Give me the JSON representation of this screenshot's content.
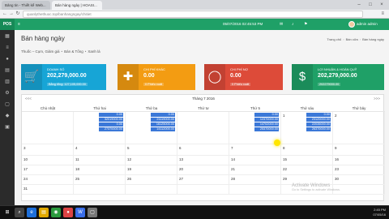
{
  "browser": {
    "tabs": [
      {
        "title": "Bảng tin - Thiết kế Web..."
      },
      {
        "title": "Bán hàng ngày | HOASI..."
      }
    ],
    "url": "quanlythethuoc.top/banhangngay/chitiet"
  },
  "header": {
    "logo": "POS",
    "date": "05/07/2016 02:45:53 PM",
    "user_name": "admin admin"
  },
  "page": {
    "title": "Bán hàng ngày",
    "breadcrumb": [
      "Trang chủ",
      "Bán cửa",
      "Bán hàng ngày"
    ],
    "filter": [
      "Thuốc – Cụm, Giảm giá",
      "Bán & Tổng",
      "Xanh lá"
    ]
  },
  "cards": [
    {
      "label": "DOANH SỐ",
      "value": "202,279,000.00",
      "sub": "Bằng tổng: 127,105,000.00",
      "color": "#17a5d6",
      "icon": "cart-icon"
    },
    {
      "label": "CHI PHÍ KHÁC",
      "value": "0.00",
      "sub": "0 Phiếu xuất",
      "color": "#f39c12",
      "icon": "plus-icon"
    },
    {
      "label": "CHI PHÍ NỢ",
      "value": "0.00",
      "sub": "0 Phiếu xuất",
      "color": "#dd4b39",
      "icon": "circle-icon"
    },
    {
      "label": "LỢI NHUẬN & HOÀN QUỸ",
      "value": "202,279,000.00",
      "sub": "202279000.00",
      "color": "#1fa067",
      "icon": "dollar-icon"
    }
  ],
  "calendar": {
    "prev": "<<<",
    "next": ">>>",
    "title": "Tháng 7 2016",
    "weekdays": [
      "Chủ nhật",
      "Thứ hai",
      "Thứ ba",
      "Thứ tư",
      "Thứ 5",
      "Thứ sáu",
      "Thứ bảy"
    ],
    "weeks": [
      {
        "days": [
          "",
          "",
          "",
          "",
          "",
          "1",
          "2"
        ]
      },
      {
        "days": [
          "3",
          "4",
          "5",
          "6",
          "7",
          "8",
          "9"
        ]
      },
      {
        "days": [
          "10",
          "11",
          "12",
          "13",
          "14",
          "15",
          "16"
        ]
      },
      {
        "days": [
          "17",
          "18",
          "19",
          "20",
          "21",
          "22",
          "23"
        ]
      },
      {
        "days": [
          "24",
          "25",
          "26",
          "27",
          "28",
          "29",
          "30"
        ]
      },
      {
        "days": [
          "31",
          "",
          "",
          "",
          "",
          "",
          ""
        ]
      }
    ],
    "marks": {
      "mon": [
        "0.00",
        "32019000.00",
        "0.00",
        "27370000.00"
      ],
      "tue": [
        "0.00",
        "21119000.00",
        "16125000.00",
        "14112000.00"
      ],
      "thu": [
        "0.00",
        "12370000.00",
        "14702000.00",
        "25370000.00"
      ],
      "fri": [
        "0.00",
        "23120000.00",
        "22035000.00",
        "26370000.00"
      ]
    }
  },
  "watermark": {
    "line1": "Activate Windows",
    "line2": "Go to Settings to activate Windows."
  },
  "clock": {
    "time": "2:45 PM",
    "date": "07/05/16"
  }
}
